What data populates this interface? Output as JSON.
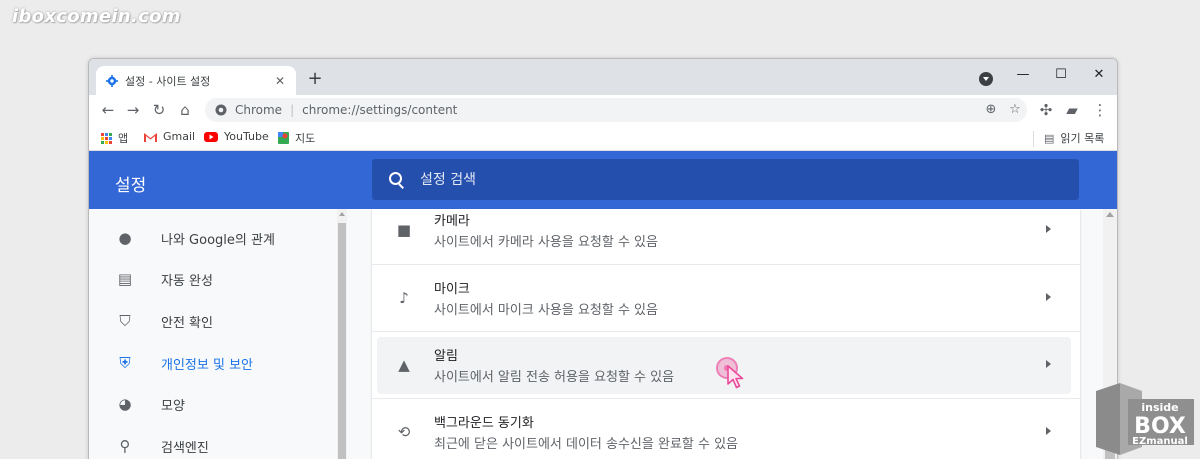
{
  "watermark_text": "iboxcomein.com",
  "tab": {
    "title": "설정 - 사이트 설정",
    "close_label": "✕",
    "new_tab_label": "+"
  },
  "window_controls": {
    "minimize": "—",
    "maximize": "☐",
    "close": "✕"
  },
  "address": {
    "site_chip": "Chrome",
    "separator": "|",
    "url": "chrome://settings/content"
  },
  "bookmarks": [
    {
      "label": "앱",
      "icon": "apps-grid-icon"
    },
    {
      "label": "Gmail",
      "icon": "gmail-icon"
    },
    {
      "label": "YouTube",
      "icon": "youtube-icon"
    },
    {
      "label": "지도",
      "icon": "maps-icon"
    }
  ],
  "reading_list": "읽기 목록",
  "header": {
    "title": "설정",
    "search_placeholder": "설정 검색"
  },
  "sidebar": {
    "items": [
      {
        "label": "나와 Google의 관계",
        "icon": "person-icon"
      },
      {
        "label": "자동 완성",
        "icon": "clipboard-icon"
      },
      {
        "label": "안전 확인",
        "icon": "shield-check-icon"
      },
      {
        "label": "개인정보 및 보안",
        "icon": "shield-privacy-icon",
        "active": true
      },
      {
        "label": "모양",
        "icon": "palette-icon"
      },
      {
        "label": "검색엔진",
        "icon": "search-icon"
      }
    ]
  },
  "permissions": [
    {
      "title": "카메라",
      "subtitle": "사이트에서 카메라 사용을 요청할 수 있음",
      "icon": "camera-icon"
    },
    {
      "title": "마이크",
      "subtitle": "사이트에서 마이크 사용을 요청할 수 있음",
      "icon": "microphone-icon"
    },
    {
      "title": "알림",
      "subtitle": "사이트에서 알림 전송 허용을 요청할 수 있음",
      "icon": "bell-icon",
      "highlighted": true
    },
    {
      "title": "백그라운드 동기화",
      "subtitle": "최근에 닫은 사이트에서 데이터 송수신을 완료할 수 있음",
      "icon": "sync-icon"
    }
  ],
  "brand_badge": {
    "line1": "inside",
    "line2": "BOX",
    "line3": "EZmanual"
  },
  "colors": {
    "header_blue": "#3367d6",
    "search_blue": "#254fad",
    "active_blue": "#1a73e8",
    "highlight_pink": "#ec4899"
  }
}
